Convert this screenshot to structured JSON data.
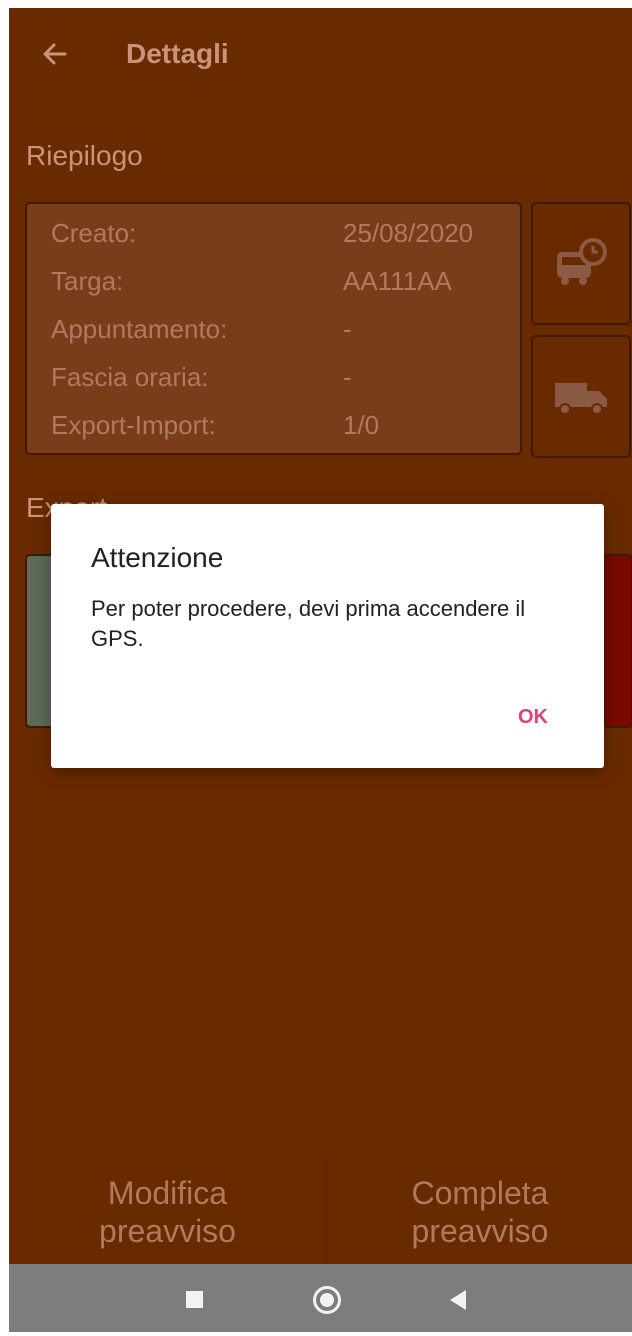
{
  "appbar": {
    "title": "Dettagli",
    "back_icon": "arrow-left-icon"
  },
  "summary": {
    "section_title": "Riepilogo",
    "rows": [
      {
        "label": "Creato:",
        "value": "25/08/2020"
      },
      {
        "label": "Targa:",
        "value": "AA111AA"
      },
      {
        "label": "Appuntamento:",
        "value": "-"
      },
      {
        "label": "Fascia oraria:",
        "value": "-"
      },
      {
        "label": "Export-Import:",
        "value": "1/0"
      }
    ],
    "side_buttons": [
      {
        "icon": "truck-clock-icon"
      },
      {
        "icon": "truck-icon"
      }
    ]
  },
  "export": {
    "section_title": "Export"
  },
  "bottom": {
    "left_line1": "Modifica",
    "left_line2": "preavviso",
    "right_line1": "Completa",
    "right_line2": "preavviso"
  },
  "dialog": {
    "title": "Attenzione",
    "message": "Per poter procedere, devi prima accendere il GPS.",
    "ok_label": "OK"
  },
  "colors": {
    "background": "#6a2a00",
    "dialog_button": "#e0407a"
  }
}
